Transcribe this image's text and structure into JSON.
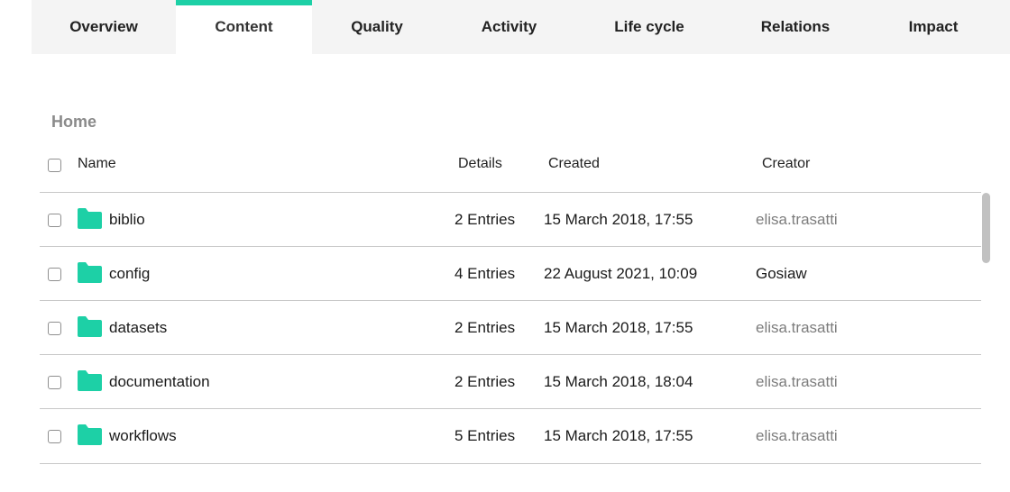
{
  "tabs": [
    {
      "label": "Overview",
      "active": false
    },
    {
      "label": "Content",
      "active": true
    },
    {
      "label": "Quality",
      "active": false
    },
    {
      "label": "Activity",
      "active": false
    },
    {
      "label": "Life cycle",
      "active": false
    },
    {
      "label": "Relations",
      "active": false
    },
    {
      "label": "Impact",
      "active": false
    }
  ],
  "breadcrumb": {
    "current": "Home"
  },
  "table": {
    "headers": {
      "name": "Name",
      "details": "Details",
      "created": "Created",
      "creator": "Creator"
    },
    "rows": [
      {
        "name": "biblio",
        "details": "2 Entries",
        "created": "15 March 2018, 17:55",
        "creator": "elisa.trasatti",
        "icon": "folder-icon"
      },
      {
        "name": "config",
        "details": "4 Entries",
        "created": "22 August 2021, 10:09",
        "creator": "Gosiaw",
        "icon": "folder-icon"
      },
      {
        "name": "datasets",
        "details": "2 Entries",
        "created": "15 March 2018, 17:55",
        "creator": "elisa.trasatti",
        "icon": "folder-icon"
      },
      {
        "name": "documentation",
        "details": "2 Entries",
        "created": "15 March 2018, 18:04",
        "creator": "elisa.trasatti",
        "icon": "folder-icon"
      },
      {
        "name": "workflows",
        "details": "5 Entries",
        "created": "15 March 2018, 17:55",
        "creator": "elisa.trasatti",
        "icon": "folder-icon"
      }
    ]
  },
  "colors": {
    "accent": "#1dd0a6",
    "tabbar_bg": "#f4f4f4",
    "muted_text": "#7d7d7d"
  }
}
